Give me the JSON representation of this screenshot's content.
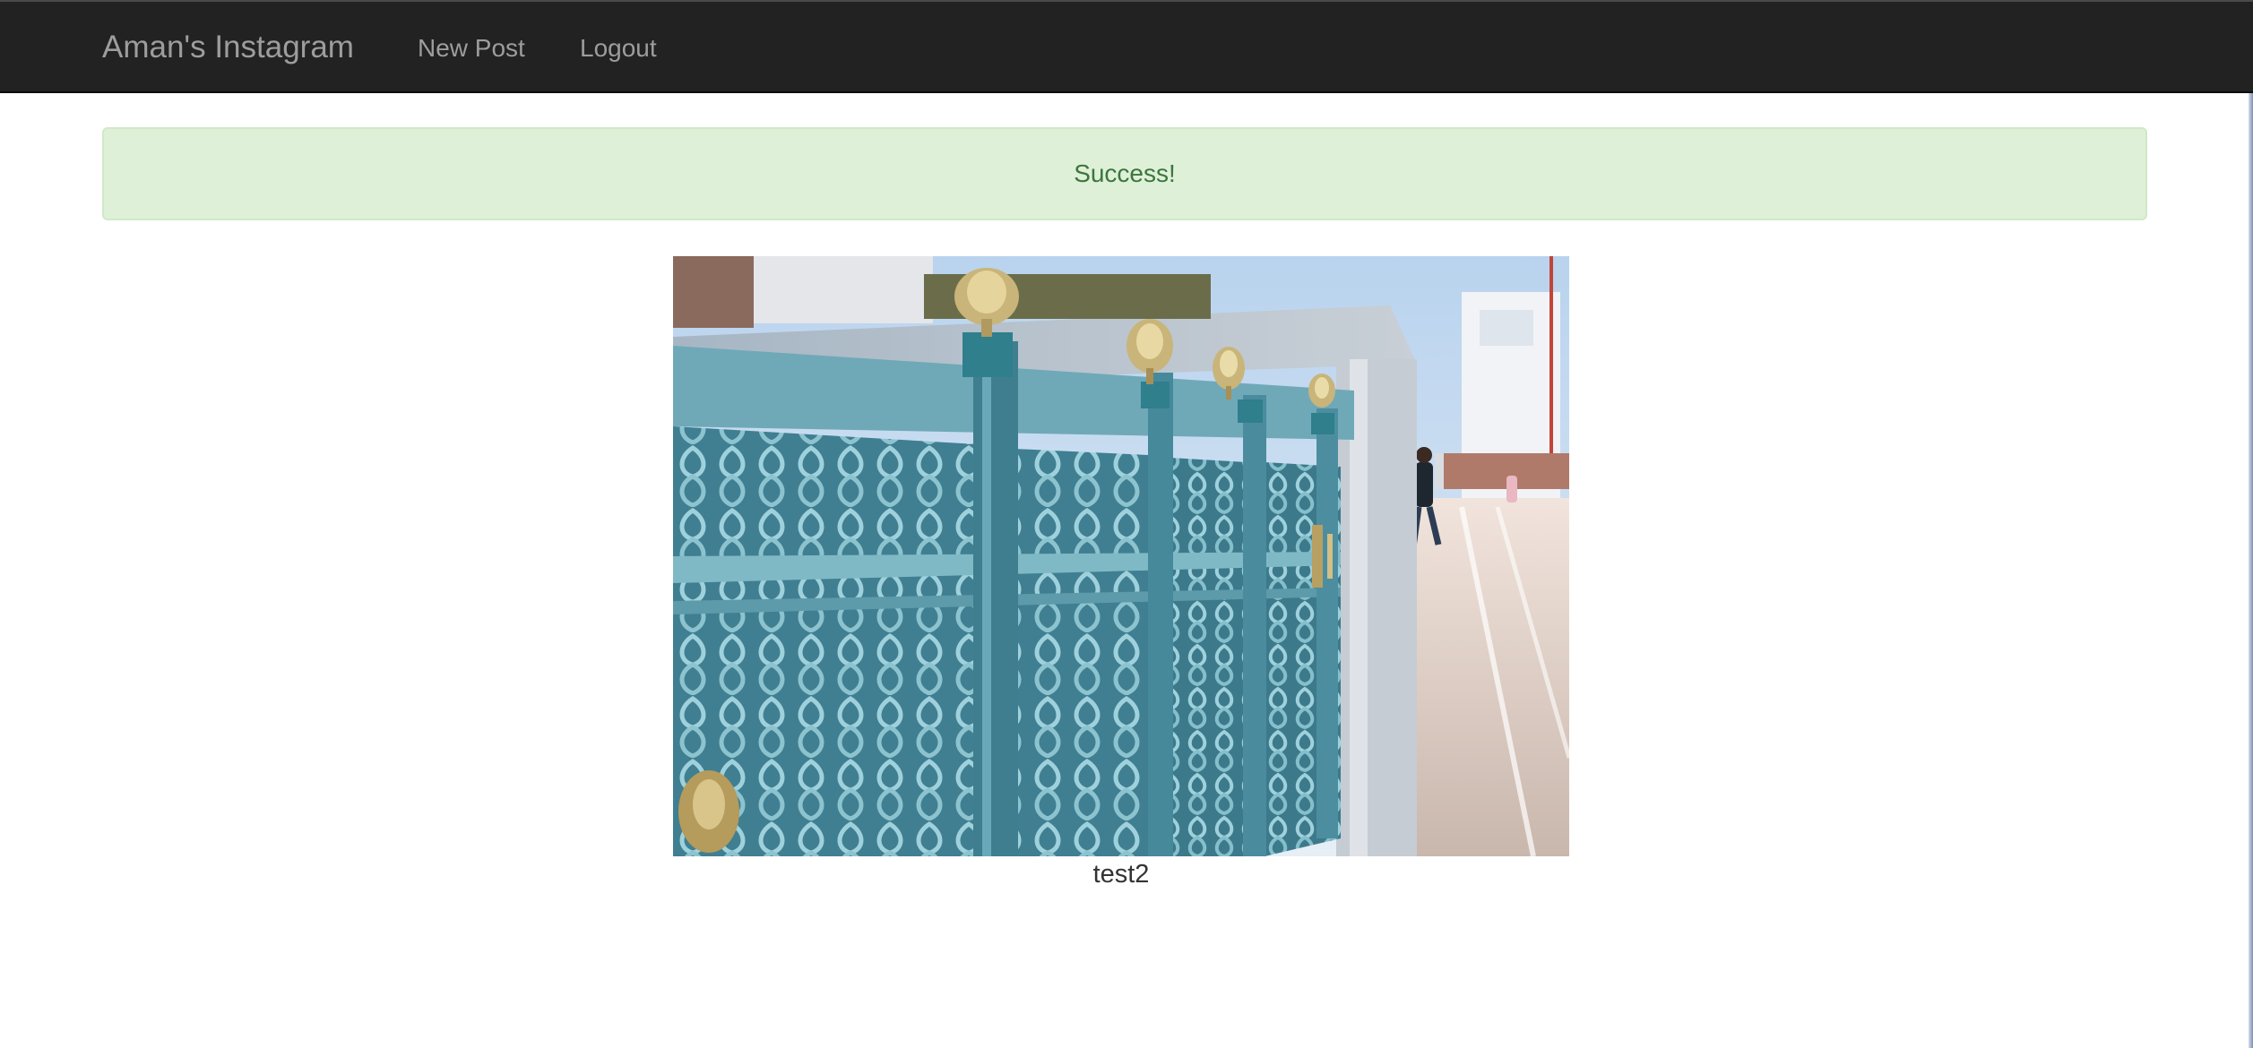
{
  "navbar": {
    "brand": "Aman's Instagram",
    "links": [
      {
        "label": "New Post"
      },
      {
        "label": "Logout"
      }
    ]
  },
  "alert": {
    "message": "Success!"
  },
  "post": {
    "caption": "test2"
  },
  "colors": {
    "navbar_bg": "#222222",
    "navbar_text": "#9d9d9d",
    "alert_bg": "#dff0d8",
    "alert_text": "#3c763d"
  }
}
